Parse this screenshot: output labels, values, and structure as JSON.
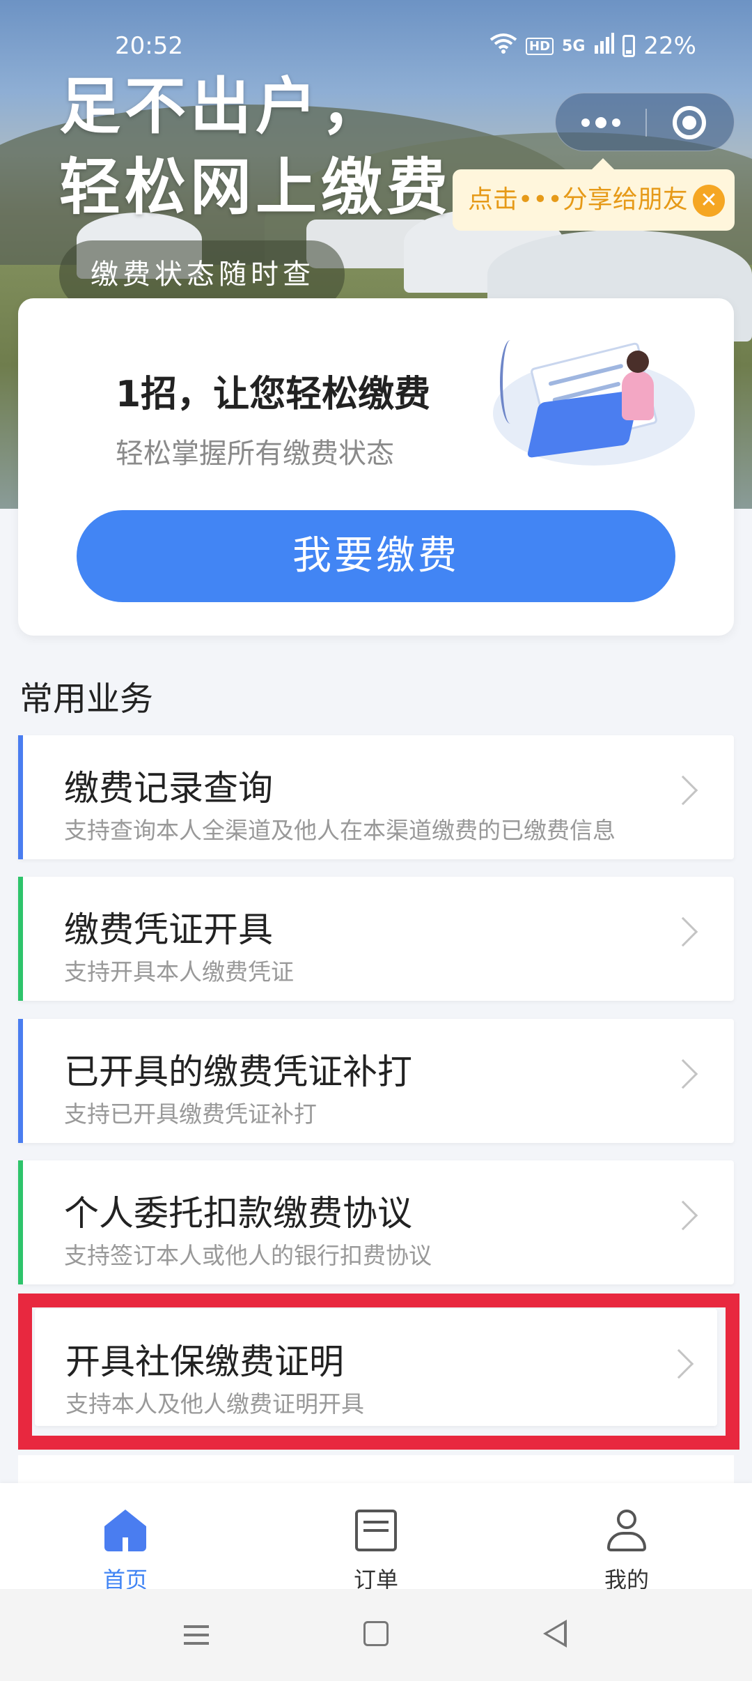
{
  "status_bar": {
    "time": "20:52",
    "hd": "HD",
    "network": "5G",
    "battery": "22%"
  },
  "hero": {
    "title_line1": "足不出户，",
    "title_line2": "轻松网上缴费",
    "subtitle": "缴费状态随时查"
  },
  "share_tip": {
    "text": "点击•••分享给朋友",
    "close": "✕"
  },
  "card": {
    "title": "1招，让您轻松缴费",
    "subtitle": "轻松掌握所有缴费状态",
    "button": "我要缴费"
  },
  "section": {
    "title": "常用业务"
  },
  "services": [
    {
      "title": "缴费记录查询",
      "desc": "支持查询本人全渠道及他人在本渠道缴费的已缴费信息",
      "accent": "#4a7df0"
    },
    {
      "title": "缴费凭证开具",
      "desc": "支持开具本人缴费凭证",
      "accent": "#2ec46b"
    },
    {
      "title": "已开具的缴费凭证补打",
      "desc": "支持已开具缴费凭证补打",
      "accent": "#4a7df0"
    },
    {
      "title": "个人委托扣款缴费协议",
      "desc": "支持签订本人或他人的银行扣费协议",
      "accent": "#2ec46b"
    },
    {
      "title": "开具社保缴费证明",
      "desc": "支持本人及他人缴费证明开具",
      "accent": "#e8283f"
    }
  ],
  "tabs": [
    {
      "label": "首页",
      "icon": "home-icon",
      "active": true
    },
    {
      "label": "订单",
      "icon": "order-icon",
      "active": false
    },
    {
      "label": "我的",
      "icon": "user-icon",
      "active": false
    }
  ],
  "colors": {
    "primary": "#4285f4",
    "highlight": "#e8283f",
    "tip_text": "#e69a18"
  }
}
